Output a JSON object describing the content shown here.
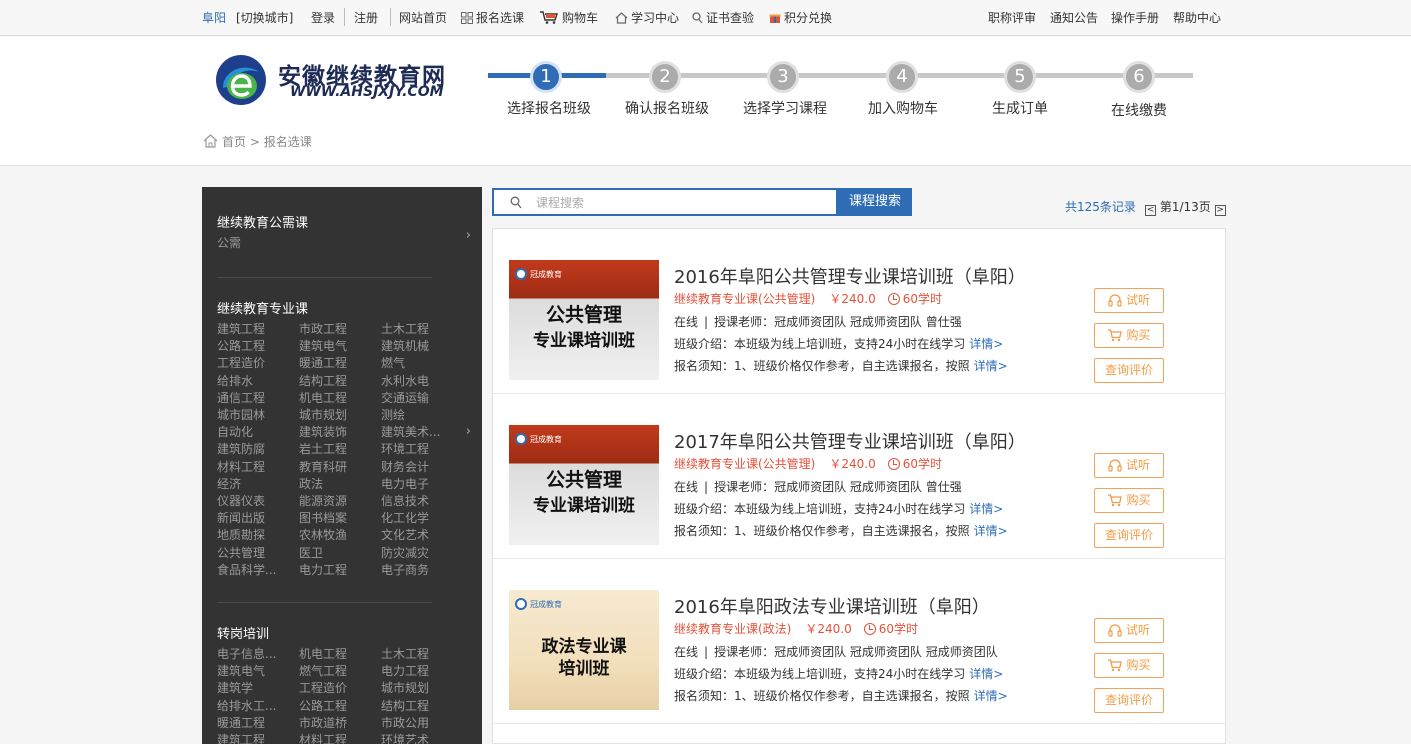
{
  "topbar": {
    "city": "阜阳",
    "switch_city": "[切换城市]",
    "login": "登录",
    "register": "注册",
    "nav": [
      "网站首页",
      "报名选课",
      "购物车",
      "学习中心",
      "证书查验",
      "积分兑换"
    ],
    "right_links": [
      "职称评审",
      "通知公告",
      "操作手册",
      "帮助中心"
    ]
  },
  "logo": {
    "cn": "安徽继续教育网",
    "en": "WWW.AHSJXJY.COM"
  },
  "steps": [
    {
      "num": "1",
      "label": "选择报名班级"
    },
    {
      "num": "2",
      "label": "确认报名班级"
    },
    {
      "num": "3",
      "label": "选择学习课程"
    },
    {
      "num": "4",
      "label": "加入购物车"
    },
    {
      "num": "5",
      "label": "生成订单"
    },
    {
      "num": "6",
      "label": "在线缴费"
    }
  ],
  "breadcrumb": {
    "home": "首页",
    "sep": ">",
    "current": "报名选课"
  },
  "sidebar": {
    "cat1": {
      "title": "继续教育公需课",
      "items": [
        "公需"
      ]
    },
    "cat2": {
      "title": "继续教育专业课",
      "items": [
        "建筑工程",
        "市政工程",
        "土木工程",
        "公路工程",
        "建筑电气",
        "建筑机械",
        "工程造价",
        "暖通工程",
        "燃气",
        "给排水",
        "结构工程",
        "水利水电",
        "通信工程",
        "机电工程",
        "交通运输",
        "城市园林",
        "城市规划",
        "测绘",
        "自动化",
        "建筑装饰",
        "建筑美术...",
        "建筑防腐",
        "岩土工程",
        "环境工程",
        "材料工程",
        "教育科研",
        "财务会计",
        "经济",
        "政法",
        "电力电子",
        "仪器仪表",
        "能源资源",
        "信息技术",
        "新闻出版",
        "图书档案",
        "化工化学",
        "地质勘探",
        "农林牧渔",
        "文化艺术",
        "公共管理",
        "医卫",
        "防灾减灾",
        "食品科学...",
        "电力工程",
        "电子商务"
      ]
    },
    "cat3": {
      "title": "转岗培训",
      "items": [
        "电子信息...",
        "机电工程",
        "土木工程",
        "建筑电气",
        "燃气工程",
        "电力工程",
        "建筑学",
        "工程造价",
        "城市规划",
        "给排水工...",
        "公路工程",
        "结构工程",
        "暖通工程",
        "市政道桥",
        "市政公用",
        "建筑工程",
        "材料工程",
        "环境艺术"
      ]
    }
  },
  "search": {
    "placeholder": "课程搜索",
    "button": "课程搜索"
  },
  "pager": {
    "total": "共125条记录",
    "prev": "<",
    "page": "第1/13页",
    "next": ">"
  },
  "courses": [
    {
      "title": "2016年阜阳公共管理专业课培训班（阜阳）",
      "category": "继续教育专业课(公共管理)",
      "price": "￥240.0",
      "hours": "60学时",
      "mode": "在线",
      "teacher_label": "授课老师：",
      "teachers": "冠成师资团队 冠成师资团队 曾仕强",
      "intro_label": "班级介绍：",
      "intro": "本班级为线上培训班，支持24小时在线学习",
      "notice_label": "报名须知：",
      "notice": "1、班级价格仅作参考，自主选课报名，按照",
      "more": "详情>",
      "thumb_brand": "冠成教育",
      "thumb_line1": "公共管理",
      "thumb_line2": "专业课培训班",
      "btn_trial": "试听",
      "btn_buy": "购买",
      "btn_review": "查询评价"
    },
    {
      "title": "2017年阜阳公共管理专业课培训班（阜阳）",
      "category": "继续教育专业课(公共管理)",
      "price": "￥240.0",
      "hours": "60学时",
      "mode": "在线",
      "teacher_label": "授课老师：",
      "teachers": "冠成师资团队 冠成师资团队 曾仕强",
      "intro_label": "班级介绍：",
      "intro": "本班级为线上培训班，支持24小时在线学习",
      "notice_label": "报名须知：",
      "notice": "1、班级价格仅作参考，自主选课报名，按照",
      "more": "详情>",
      "thumb_brand": "冠成教育",
      "thumb_line1": "公共管理",
      "thumb_line2": "专业课培训班",
      "btn_trial": "试听",
      "btn_buy": "购买",
      "btn_review": "查询评价"
    },
    {
      "title": "2016年阜阳政法专业课培训班（阜阳）",
      "category": "继续教育专业课(政法)",
      "price": "￥240.0",
      "hours": "60学时",
      "mode": "在线",
      "teacher_label": "授课老师：",
      "teachers": "冠成师资团队 冠成师资团队 冠成师资团队",
      "intro_label": "班级介绍：",
      "intro": "本班级为线上培训班，支持24小时在线学习",
      "notice_label": "报名须知：",
      "notice": "1、班级价格仅作参考，自主选课报名，按照",
      "more": "详情>",
      "thumb_brand": "冠成教育",
      "thumb_line1": "政法专业课",
      "thumb_line2": "培训班",
      "btn_trial": "试听",
      "btn_buy": "购买",
      "btn_review": "查询评价"
    }
  ]
}
